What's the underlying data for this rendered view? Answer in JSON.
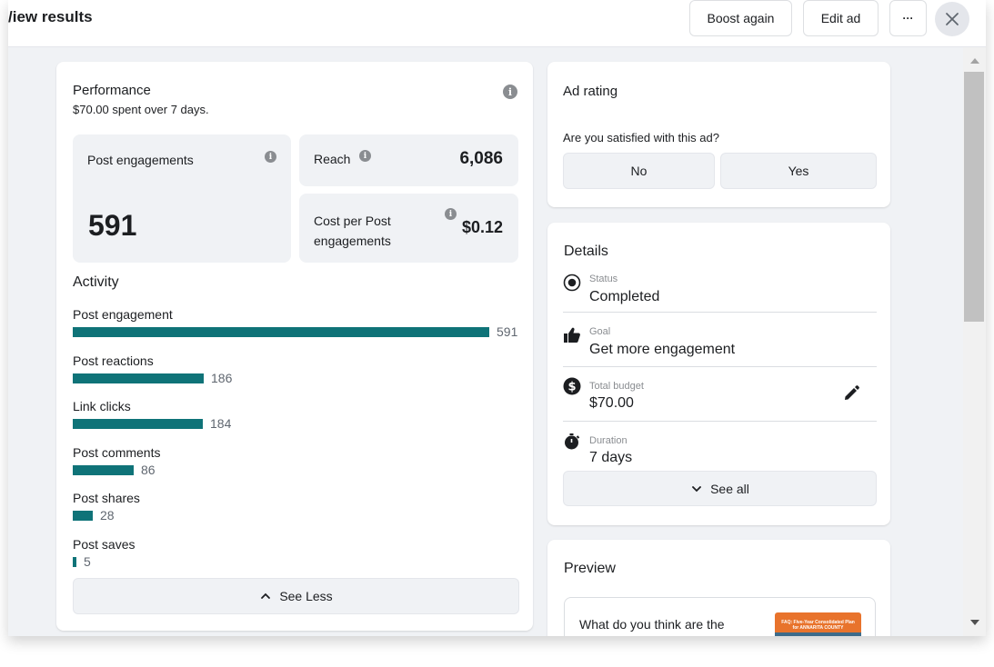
{
  "header": {
    "title": "/iew results",
    "boost_again": "Boost again",
    "edit_ad": "Edit ad",
    "more": "···"
  },
  "performance": {
    "title": "Performance",
    "subtitle": "$70.00 spent over 7 days.",
    "post_engagements_label": "Post engagements",
    "post_engagements_value": "591",
    "reach_label": "Reach",
    "reach_value": "6,086",
    "cpe_label_line1": "Cost per Post",
    "cpe_label_line2": "engagements",
    "cpe_value": "$0.12"
  },
  "activity": {
    "title": "Activity",
    "max": 591,
    "items": [
      {
        "label": "Post engagement",
        "value": 591
      },
      {
        "label": "Post reactions",
        "value": 186
      },
      {
        "label": "Link clicks",
        "value": 184
      },
      {
        "label": "Post comments",
        "value": 86
      },
      {
        "label": "Post shares",
        "value": 28
      },
      {
        "label": "Post saves",
        "value": 5
      }
    ],
    "see_less": "See Less"
  },
  "ad_rating": {
    "title": "Ad rating",
    "question": "Are you satisfied with this ad?",
    "no": "No",
    "yes": "Yes"
  },
  "details": {
    "title": "Details",
    "status_label": "Status",
    "status_value": "Completed",
    "goal_label": "Goal",
    "goal_value": "Get more engagement",
    "budget_label": "Total budget",
    "budget_value": "$70.00",
    "duration_label": "Duration",
    "duration_value": "7 days",
    "see_all": "See all"
  },
  "preview": {
    "title": "Preview",
    "post_text": "What do you think are the",
    "thumbnail_text_line1": "FAQ: Five-Year Consolidated Plan",
    "thumbnail_text_line2": "for ANNARITA COUNTY"
  },
  "colors": {
    "bar": "#0f7378",
    "background": "#f0f2f5"
  }
}
